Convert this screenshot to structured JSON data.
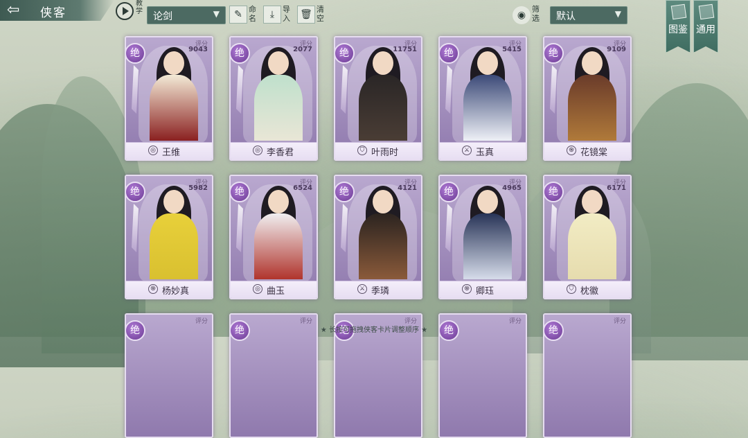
{
  "header": {
    "back_icon": "back-arrow-icon",
    "title": "侠客",
    "tutorial_label": "教学",
    "preset_select": "论剑",
    "tools": {
      "name": "命名",
      "import": "导入",
      "clear": "清空"
    },
    "filter_label": "筛选",
    "sort_select": "默认",
    "banners": {
      "atlas": "图鉴",
      "general": "通用"
    }
  },
  "score_label": "评分",
  "rank_label": "绝",
  "cards": [
    {
      "name": "王维",
      "score": "9043",
      "faction_icon": "circle-icon",
      "colors": [
        "#f3ead6",
        "#8a2020"
      ]
    },
    {
      "name": "李香君",
      "score": "2077",
      "faction_icon": "circle-icon",
      "colors": [
        "#bfe0cc",
        "#e9e6d6"
      ]
    },
    {
      "name": "叶雨时",
      "score": "11751",
      "faction_icon": "shield-icon",
      "colors": [
        "#2a2626",
        "#4a3d35"
      ]
    },
    {
      "name": "玉真",
      "score": "5415",
      "faction_icon": "sword-icon",
      "colors": [
        "#3c4a78",
        "#eef0f6"
      ]
    },
    {
      "name": "花镜棠",
      "score": "9109",
      "faction_icon": "swirl-icon",
      "colors": [
        "#6a3b2a",
        "#b07a3a"
      ]
    },
    {
      "name": "杨妙真",
      "score": "5982",
      "faction_icon": "swirl-icon",
      "colors": [
        "#e8d03a",
        "#d9c030"
      ]
    },
    {
      "name": "曲玉",
      "score": "6524",
      "faction_icon": "circle-icon",
      "colors": [
        "#f0eef0",
        "#b0342c"
      ]
    },
    {
      "name": "季璘",
      "score": "4121",
      "faction_icon": "sword-icon",
      "colors": [
        "#2c2420",
        "#8a5a3a"
      ]
    },
    {
      "name": "卿珏",
      "score": "4965",
      "faction_icon": "swirl-icon",
      "colors": [
        "#283457",
        "#d6dcea"
      ]
    },
    {
      "name": "枕徽",
      "score": "6171",
      "faction_icon": "shield-icon",
      "colors": [
        "#f2ecc4",
        "#e6dcae"
      ]
    }
  ],
  "hint": "长按可拖拽侠客卡片调整顺序"
}
